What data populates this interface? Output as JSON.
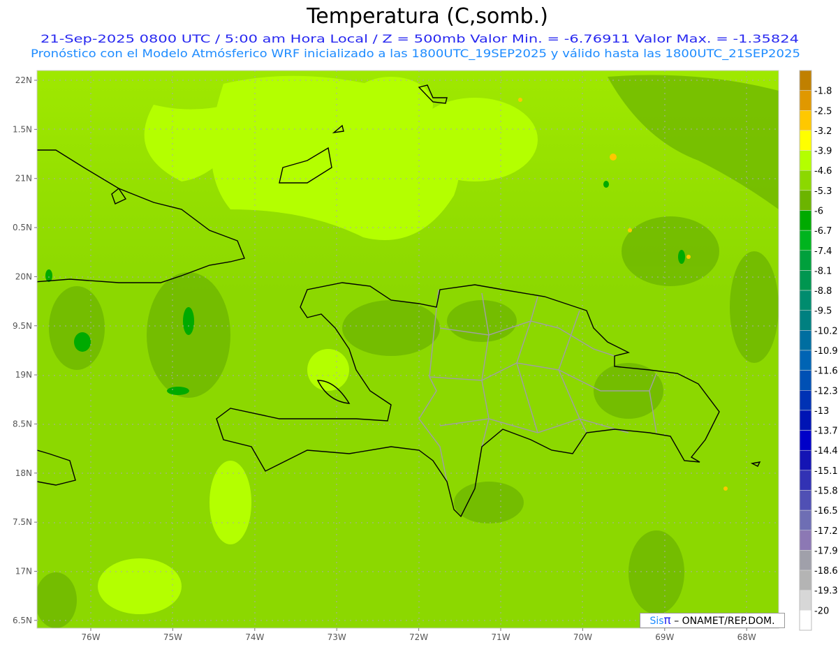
{
  "header": {
    "title": "Temperatura (C,somb.)",
    "line1": "21-Sep-2025  0800 UTC / 5:00 am Hora Local / Z = 500mb  Valor Min. = -6.76911  Valor Max. = -1.35824",
    "line2": "Pronóstico con el Modelo Atmósferico WRF inicializado a las 1800UTC_19SEP2025 y válido hasta las  1800UTC_21SEP2025"
  },
  "axes": {
    "lat_labels": [
      "22N",
      "1.5N",
      "21N",
      "0.5N",
      "20N",
      "9.5N",
      "19N",
      "8.5N",
      "18N",
      "7.5N",
      "17N",
      "6.5N"
    ],
    "lon_labels": [
      "76W",
      "75W",
      "74W",
      "73W",
      "72W",
      "71W",
      "70W",
      "69W",
      "68W"
    ]
  },
  "colorbar": {
    "labels": [
      "-1.8",
      "-2.5",
      "-3.2",
      "-3.9",
      "-4.6",
      "-5.3",
      "-6",
      "-6.7",
      "-7.4",
      "-8.1",
      "-8.8",
      "-9.5",
      "-10.2",
      "-10.9",
      "-11.6",
      "-12.3",
      "-13",
      "-13.7",
      "-14.4",
      "-15.1",
      "-15.8",
      "-16.5",
      "-17.2",
      "-17.9",
      "-18.6",
      "-19.3",
      "-20"
    ],
    "colors": [
      "#c08000",
      "#e09800",
      "#ffc800",
      "#ffff00",
      "#b4ff00",
      "#8cd800",
      "#6cb400",
      "#00aa00",
      "#00b41e",
      "#00a03c",
      "#009650",
      "#008c6e",
      "#008080",
      "#006ea0",
      "#0064b4",
      "#0050b4",
      "#0032b4",
      "#0014b4",
      "#0000c8",
      "#1414b4",
      "#3232b4",
      "#5050b4",
      "#6e6eb4",
      "#8c78b4",
      "#a0a0aa",
      "#b4b4b4",
      "#d7d7d7",
      "#ffffff"
    ]
  },
  "credit": {
    "sis": "Sis",
    "pi": "π",
    "rest": " –  ONAMET/REP.DOM."
  }
}
